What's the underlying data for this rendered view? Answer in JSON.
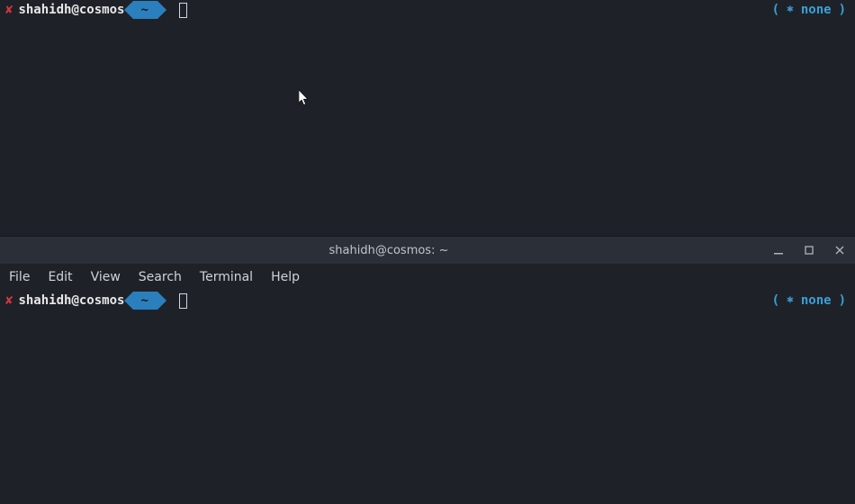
{
  "top": {
    "x_mark": "✘",
    "user_host": "shahidh@cosmos",
    "cwd": "~",
    "right_open": "(",
    "right_wheel": "⎈",
    "right_text": "none",
    "right_close": ")"
  },
  "window": {
    "title": "shahidh@cosmos: ~",
    "menus": [
      "File",
      "Edit",
      "View",
      "Search",
      "Terminal",
      "Help"
    ]
  },
  "bottom": {
    "x_mark": "✘",
    "user_host": "shahidh@cosmos",
    "cwd": "~",
    "right_open": "(",
    "right_wheel": "⎈",
    "right_text": "none",
    "right_close": ")"
  }
}
